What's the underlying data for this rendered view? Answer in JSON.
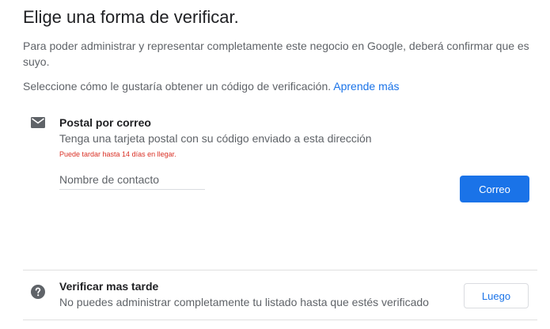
{
  "header": {
    "title": "Elige una forma de verificar."
  },
  "intro": {
    "text": "Para poder administrar y representar completamente este negocio en Google, deberá confirmar que es suyo.",
    "select_prompt": "Seleccione cómo le gustaría obtener un código de verificación.",
    "learn_more": "Aprende más"
  },
  "postal_option": {
    "icon": "mail-icon",
    "title": "Postal por correo",
    "description": "Tenga una tarjeta postal con su código enviado a esta dirección",
    "warning": "Puede tardar hasta 14 días en llegar.",
    "contact_placeholder": "Nombre de contacto",
    "contact_value": "",
    "button_label": "Correo"
  },
  "later_option": {
    "icon": "help-circle-icon",
    "title": "Verificar mas tarde",
    "description": "No puedes administrar completamente tu listado hasta que estés verificado",
    "button_label": "Luego"
  },
  "colors": {
    "primary": "#1a73e8",
    "warning": "#d93025",
    "icon": "#5f6368"
  }
}
